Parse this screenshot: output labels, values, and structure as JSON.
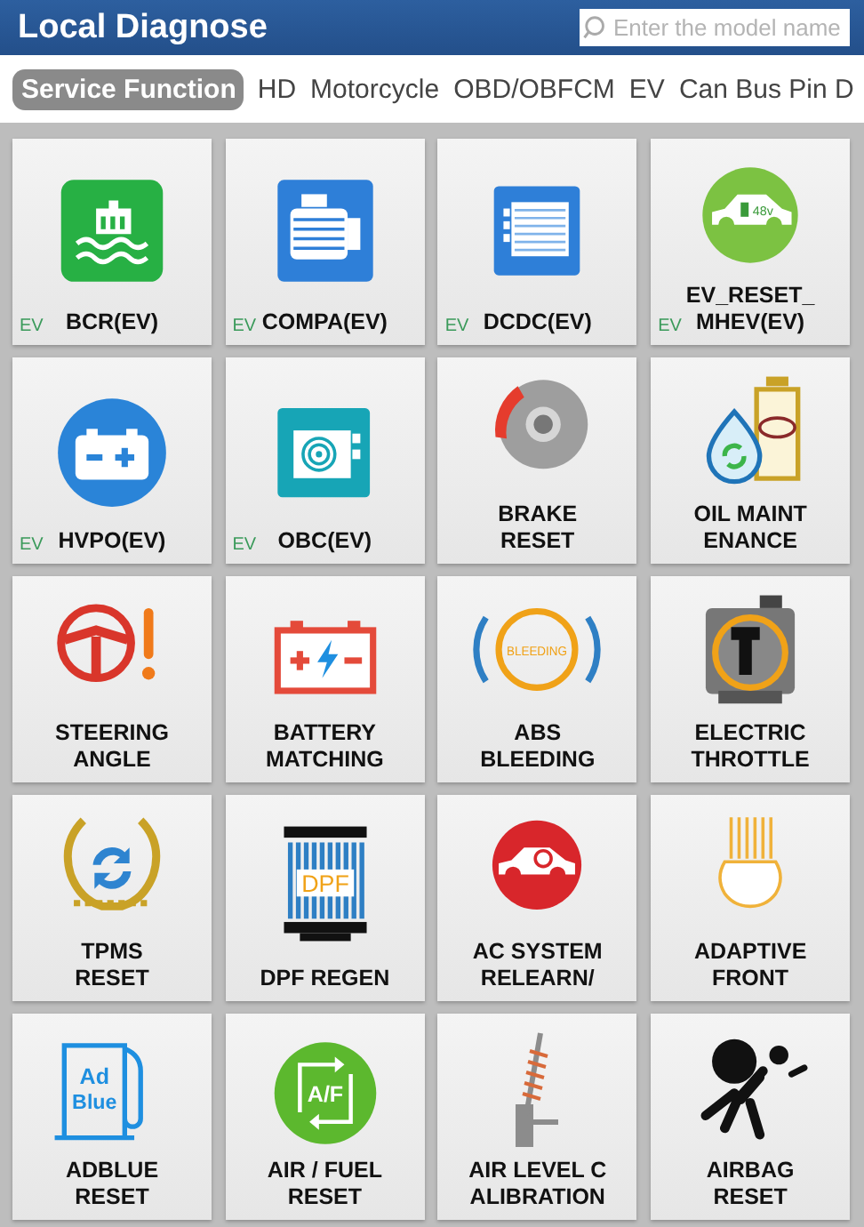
{
  "header": {
    "title": "Local Diagnose",
    "search": {
      "placeholder": "Enter the model name"
    }
  },
  "tabs": [
    {
      "label": "Service Function",
      "selected": true
    },
    {
      "label": "HD",
      "selected": false
    },
    {
      "label": "Motorcycle",
      "selected": false
    },
    {
      "label": "OBD/OBFCM",
      "selected": false
    },
    {
      "label": "EV",
      "selected": false
    },
    {
      "label": "Can Bus Pin D",
      "selected": false
    }
  ],
  "tiles": [
    {
      "kind": "coolant",
      "label": [
        "BCR(EV)"
      ],
      "badge": "EV"
    },
    {
      "kind": "compressor",
      "label": [
        "COMPA(EV)"
      ],
      "badge": "EV"
    },
    {
      "kind": "dcdc",
      "label": [
        "DCDC(EV)"
      ],
      "badge": "EV"
    },
    {
      "kind": "evcar",
      "icon_text": [
        "48v"
      ],
      "label": [
        "EV_RESET_",
        "MHEV(EV)"
      ],
      "badge": "EV"
    },
    {
      "kind": "hvbattery",
      "label": [
        "HVPO(EV)"
      ],
      "badge": "EV"
    },
    {
      "kind": "obc",
      "label": [
        "OBC(EV)"
      ],
      "badge": "EV"
    },
    {
      "kind": "brake",
      "label": [
        "BRAKE",
        "RESET"
      ]
    },
    {
      "kind": "oil",
      "label": [
        "OIL MAINT",
        "ENANCE"
      ]
    },
    {
      "kind": "steering",
      "label": [
        "STEERING",
        "ANGLE"
      ]
    },
    {
      "kind": "battery",
      "label": [
        "BATTERY",
        "MATCHING"
      ]
    },
    {
      "kind": "abs",
      "icon_text": [
        "BLEEDING"
      ],
      "label": [
        "ABS",
        "BLEEDING"
      ]
    },
    {
      "kind": "throttle",
      "label": [
        "ELECTRIC",
        "THROTTLE"
      ]
    },
    {
      "kind": "tpms",
      "label": [
        "TPMS",
        "RESET"
      ]
    },
    {
      "kind": "dpf",
      "icon_text": [
        "DPF"
      ],
      "label": [
        "DPF REGEN"
      ]
    },
    {
      "kind": "ac",
      "label": [
        "AC SYSTEM",
        "RELEARN/"
      ]
    },
    {
      "kind": "headlight",
      "label": [
        "ADAPTIVE",
        "FRONT"
      ]
    },
    {
      "kind": "adblue",
      "icon_text": [
        "Ad",
        "Blue"
      ],
      "label": [
        "ADBLUE",
        "RESET"
      ]
    },
    {
      "kind": "airfuel",
      "icon_text": [
        "A/F"
      ],
      "label": [
        "AIR / FUEL",
        "RESET"
      ]
    },
    {
      "kind": "suspension",
      "label": [
        "AIR LEVEL C",
        "ALIBRATION"
      ]
    },
    {
      "kind": "airbag",
      "label": [
        "AIRBAG",
        "RESET"
      ]
    }
  ]
}
